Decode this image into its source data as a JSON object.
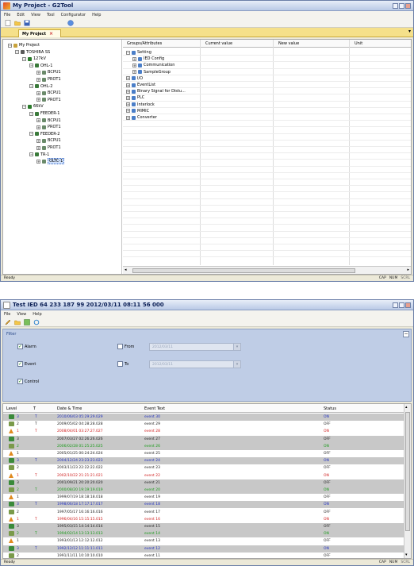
{
  "window1": {
    "title": "My Project - G2Tool",
    "menu": [
      "File",
      "Edit",
      "View",
      "Tool",
      "Configurator",
      "Help"
    ],
    "tab_label": "My Project",
    "tree": [
      {
        "label": "My Project",
        "depth": 0,
        "expander": "−",
        "icon": "folder-icon",
        "color": "#c8a23a"
      },
      {
        "label": "TOSHIBA SS",
        "depth": 1,
        "expander": "−",
        "icon": "substation-icon",
        "color": "#5a5a5a"
      },
      {
        "label": "127kV",
        "depth": 2,
        "expander": "−",
        "icon": "voltage-icon",
        "color": "#2a7a2a"
      },
      {
        "label": "OHL-1",
        "depth": 3,
        "expander": "−",
        "icon": "bay-icon",
        "color": "#3a7a3a"
      },
      {
        "label": "BCPU1",
        "depth": 4,
        "expander": "+",
        "icon": "ied-icon",
        "color": "#6a8a6a"
      },
      {
        "label": "PROT1",
        "depth": 4,
        "expander": "+",
        "icon": "ied-icon",
        "color": "#6a8a6a"
      },
      {
        "label": "OHL-2",
        "depth": 3,
        "expander": "−",
        "icon": "bay-icon",
        "color": "#3a7a3a"
      },
      {
        "label": "BCPU1",
        "depth": 4,
        "expander": "+",
        "icon": "ied-icon",
        "color": "#6a8a6a"
      },
      {
        "label": "PROT1",
        "depth": 4,
        "expander": "+",
        "icon": "ied-icon",
        "color": "#6a8a6a"
      },
      {
        "label": "66kV",
        "depth": 2,
        "expander": "−",
        "icon": "voltage-icon",
        "color": "#2a7a2a"
      },
      {
        "label": "FEEDER-1",
        "depth": 3,
        "expander": "−",
        "icon": "bay-icon",
        "color": "#3a7a3a"
      },
      {
        "label": "BCPU1",
        "depth": 4,
        "expander": "+",
        "icon": "ied-icon",
        "color": "#6a8a6a"
      },
      {
        "label": "PROT1",
        "depth": 4,
        "expander": "+",
        "icon": "ied-icon",
        "color": "#6a8a6a"
      },
      {
        "label": "FEEDER-2",
        "depth": 3,
        "expander": "−",
        "icon": "bay-icon",
        "color": "#3a7a3a"
      },
      {
        "label": "BCPU1",
        "depth": 4,
        "expander": "+",
        "icon": "ied-icon",
        "color": "#6a8a6a"
      },
      {
        "label": "PROT1",
        "depth": 4,
        "expander": "+",
        "icon": "ied-icon",
        "color": "#6a8a6a"
      },
      {
        "label": "TR-1",
        "depth": 3,
        "expander": "−",
        "icon": "bay-icon",
        "color": "#3a7a3a"
      },
      {
        "label": "OLTC-1",
        "depth": 4,
        "expander": "+",
        "icon": "ied-icon",
        "color": "#6a8a6a",
        "selected": true
      }
    ],
    "grid_headers": [
      "Groups/Attributes",
      "Current value",
      "New value",
      "Unit"
    ],
    "grid_nodes": [
      {
        "label": "Setting",
        "depth": 0,
        "expander": "−"
      },
      {
        "label": "IED Config",
        "depth": 1,
        "expander": "+"
      },
      {
        "label": "Communication",
        "depth": 1,
        "expander": "+"
      },
      {
        "label": "SampleGroup",
        "depth": 1,
        "expander": "+"
      },
      {
        "label": "I/O",
        "depth": 0,
        "expander": "+"
      },
      {
        "label": "EventList",
        "depth": 0,
        "expander": "+"
      },
      {
        "label": "Binary Signal for Distu...",
        "depth": 0,
        "expander": "+"
      },
      {
        "label": "PLC",
        "depth": 0,
        "expander": "+"
      },
      {
        "label": "Interlock",
        "depth": 0,
        "expander": "+"
      },
      {
        "label": "MIMIC",
        "depth": 0,
        "expander": "+"
      },
      {
        "label": "Converter",
        "depth": 0,
        "expander": "+"
      }
    ],
    "status_text": "Ready",
    "status_indicators": [
      "CAP",
      "NUM",
      "SCRL"
    ]
  },
  "window2": {
    "title": "Test IED 64 233 187 99 2012/03/11 08:11 56 000",
    "menu": [
      "File",
      "View",
      "Help"
    ],
    "filter": {
      "title": "Filter",
      "alarm": "Alarm",
      "event": "Event",
      "control": "Control",
      "from": "From",
      "to": "To",
      "from_value": "2012/03/11",
      "to_value": "2012/03/11"
    },
    "headers": {
      "level": "Level",
      "t": "T",
      "datetime": "Date & Time",
      "text": "Event Text",
      "status": "Status"
    },
    "colors": {
      "black": "#222222",
      "green": "#1a9a1a",
      "red": "#d02020",
      "blue": "#2030c0"
    },
    "rows": [
      {
        "level": "3",
        "t": "T",
        "date": "2010/06/03 05:29:29.029",
        "text": "event 30",
        "status": "ON",
        "color": "blue",
        "grey": true,
        "icon": "info"
      },
      {
        "level": "2",
        "t": "T",
        "date": "2009/05/02 04:28:28.028",
        "text": "event 29",
        "status": "OFF",
        "color": "black",
        "grey": false,
        "icon": "warn"
      },
      {
        "level": "1",
        "t": "T",
        "date": "2008/04/01 03:27:27.027",
        "text": "event 28",
        "status": "ON",
        "color": "red",
        "grey": false,
        "icon": "alarm"
      },
      {
        "level": "3",
        "t": "",
        "date": "2007/03/27 02:26:26.026",
        "text": "event 27",
        "status": "OFF",
        "color": "black",
        "grey": true,
        "icon": "info"
      },
      {
        "level": "2",
        "t": "",
        "date": "2006/02/28 01:25:25.025",
        "text": "event 26",
        "status": "ON",
        "color": "green",
        "grey": true,
        "icon": "warn"
      },
      {
        "level": "1",
        "t": "",
        "date": "2005/01/25 00:24:24.024",
        "text": "event 25",
        "status": "OFF",
        "color": "black",
        "grey": false,
        "icon": "alarm"
      },
      {
        "level": "3",
        "t": "T",
        "date": "2004/12/24 23:23:23.023",
        "text": "event 24",
        "status": "ON",
        "color": "blue",
        "grey": true,
        "icon": "info"
      },
      {
        "level": "2",
        "t": "",
        "date": "2003/11/23 22:22:22.022",
        "text": "event 23",
        "status": "OFF",
        "color": "black",
        "grey": false,
        "icon": "warn"
      },
      {
        "level": "1",
        "t": "T",
        "date": "2002/10/22 21:21:21.021",
        "text": "event 22",
        "status": "ON",
        "color": "red",
        "grey": false,
        "icon": "alarm"
      },
      {
        "level": "3",
        "t": "",
        "date": "2001/09/21 20:20:20.020",
        "text": "event 21",
        "status": "OFF",
        "color": "black",
        "grey": true,
        "icon": "info"
      },
      {
        "level": "2",
        "t": "T",
        "date": "2000/08/20 19:19:19.019",
        "text": "event 20",
        "status": "ON",
        "color": "green",
        "grey": true,
        "icon": "warn"
      },
      {
        "level": "1",
        "t": "",
        "date": "1999/07/19 18:18:18.018",
        "text": "event 19",
        "status": "OFF",
        "color": "black",
        "grey": false,
        "icon": "alarm"
      },
      {
        "level": "3",
        "t": "T",
        "date": "1998/06/18 17:17:17.017",
        "text": "event 18",
        "status": "ON",
        "color": "blue",
        "grey": true,
        "icon": "info"
      },
      {
        "level": "2",
        "t": "",
        "date": "1997/05/17 16:16:16.016",
        "text": "event 17",
        "status": "OFF",
        "color": "black",
        "grey": false,
        "icon": "warn"
      },
      {
        "level": "1",
        "t": "T",
        "date": "1996/04/16 15:15:15.015",
        "text": "event 16",
        "status": "ON",
        "color": "red",
        "grey": false,
        "icon": "alarm"
      },
      {
        "level": "3",
        "t": "",
        "date": "1995/03/15 14:14:14.014",
        "text": "event 15",
        "status": "OFF",
        "color": "black",
        "grey": true,
        "icon": "info"
      },
      {
        "level": "2",
        "t": "T",
        "date": "1994/02/14 13:13:13.013",
        "text": "event 14",
        "status": "ON",
        "color": "green",
        "grey": true,
        "icon": "warn"
      },
      {
        "level": "1",
        "t": "",
        "date": "1993/01/13 12:12:12.012",
        "text": "event 13",
        "status": "OFF",
        "color": "black",
        "grey": false,
        "icon": "alarm"
      },
      {
        "level": "3",
        "t": "T",
        "date": "1992/12/12 11:11:11.011",
        "text": "event 12",
        "status": "ON",
        "color": "blue",
        "grey": true,
        "icon": "info"
      },
      {
        "level": "2",
        "t": "",
        "date": "1991/11/11 10:10:10.010",
        "text": "event 11",
        "status": "OFF",
        "color": "black",
        "grey": false,
        "icon": "warn"
      }
    ],
    "status_text": "Ready",
    "status_indicators": [
      "CAP",
      "NUM",
      "SCRL"
    ]
  }
}
